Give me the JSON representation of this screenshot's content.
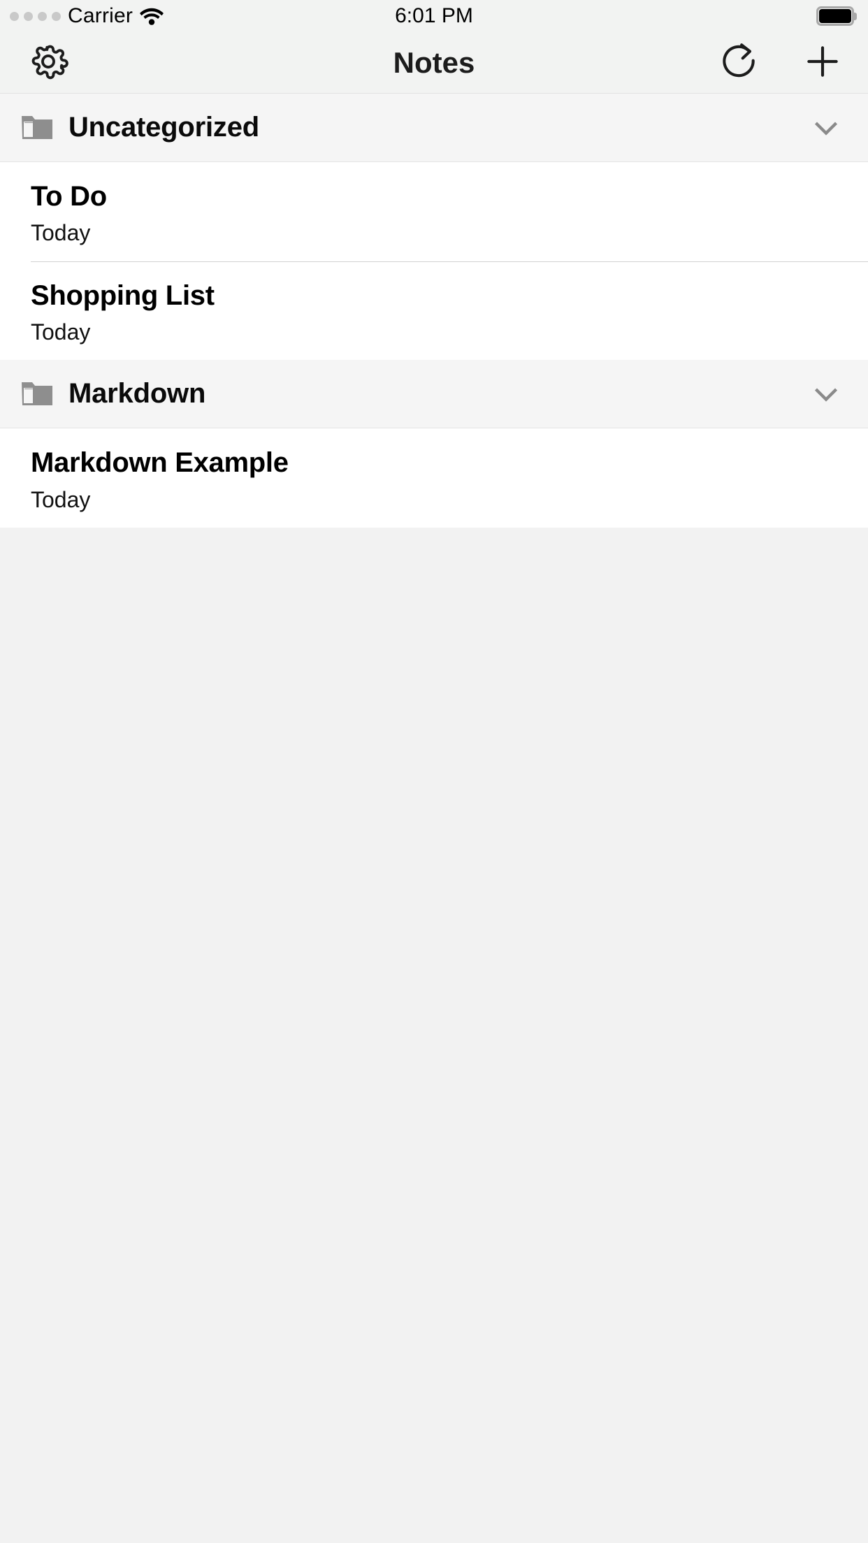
{
  "status_bar": {
    "signal_label": "signal-dots",
    "signal_bars_filled": 0,
    "signal_bars_total": 4,
    "carrier": "Carrier",
    "wifi_icon": "wifi-icon",
    "time": "6:01 PM",
    "battery_icon": "battery-full-icon",
    "battery_level_percent": 100
  },
  "nav": {
    "title": "Notes",
    "settings_icon": "gear-icon",
    "refresh_icon": "refresh-icon",
    "add_icon": "plus-icon"
  },
  "colors": {
    "chrome_background": "#f2f3f2",
    "section_header_background": "#f5f5f5",
    "row_background": "#ffffff",
    "page_background": "#f2f2f2",
    "folder_icon": "#8e8e8e",
    "chevron": "#8a8a8a",
    "separator": "#d2d2d2",
    "text_primary": "#000000",
    "battery_outline": "#a8a8a8",
    "signal_dot": "#c9c9c9"
  },
  "sections": [
    {
      "folder_icon": "folder-icon",
      "title": "Uncategorized",
      "chevron_icon": "chevron-down-icon",
      "expanded": true,
      "notes": [
        {
          "title": "To Do",
          "date": "Today"
        },
        {
          "title": "Shopping List",
          "date": "Today"
        }
      ]
    },
    {
      "folder_icon": "folder-icon",
      "title": "Markdown",
      "chevron_icon": "chevron-down-icon",
      "expanded": true,
      "notes": [
        {
          "title": "Markdown Example",
          "date": "Today"
        }
      ]
    }
  ]
}
